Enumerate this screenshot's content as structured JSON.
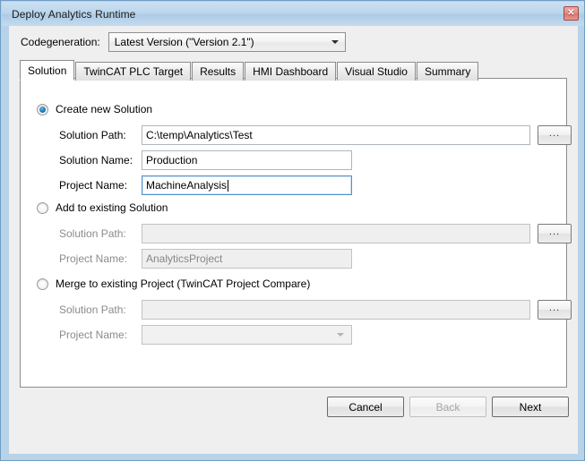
{
  "window": {
    "title": "Deploy Analytics Runtime",
    "close_label": "✕"
  },
  "codegeneration": {
    "label": "Codegeneration:",
    "selected": "Latest Version (\"Version 2.1\")"
  },
  "tabs": [
    {
      "label": "Solution",
      "active": true
    },
    {
      "label": "TwinCAT PLC Target",
      "active": false
    },
    {
      "label": "Results",
      "active": false
    },
    {
      "label": "HMI Dashboard",
      "active": false
    },
    {
      "label": "Visual Studio",
      "active": false
    },
    {
      "label": "Summary",
      "active": false
    }
  ],
  "browse_label": "...",
  "groups": {
    "create_new": {
      "radio_label": "Create new Solution",
      "selected": true,
      "solution_path_label": "Solution Path:",
      "solution_path_value": "C:\\temp\\Analytics\\Test",
      "solution_name_label": "Solution Name:",
      "solution_name_value": "Production",
      "project_name_label": "Project Name:",
      "project_name_value": "MachineAnalysis"
    },
    "add_existing": {
      "radio_label": "Add to existing Solution",
      "selected": false,
      "solution_path_label": "Solution Path:",
      "solution_path_value": "",
      "project_name_label": "Project Name:",
      "project_name_value": "AnalyticsProject"
    },
    "merge_existing": {
      "radio_label": "Merge to existing Project (TwinCAT Project Compare)",
      "selected": false,
      "solution_path_label": "Solution Path:",
      "solution_path_value": "",
      "project_name_label": "Project Name:",
      "project_name_value": ""
    }
  },
  "buttons": {
    "cancel": "Cancel",
    "back": "Back",
    "next": "Next"
  }
}
